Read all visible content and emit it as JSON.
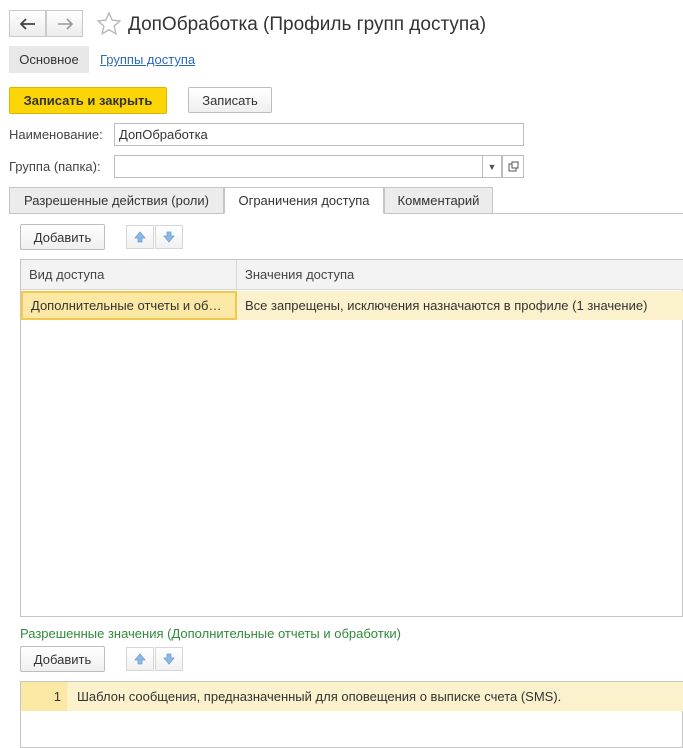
{
  "window": {
    "title": "ДопОбработка (Профиль групп доступа)"
  },
  "nav": {
    "back_icon": "arrow-left-icon",
    "forward_icon": "arrow-right-icon",
    "favorite_icon": "star-icon"
  },
  "sections": {
    "active": "Основное",
    "link": "Группы доступа"
  },
  "toolbar": {
    "save_close_label": "Записать и закрыть",
    "save_label": "Записать"
  },
  "fields": {
    "name_label": "Наименование:",
    "name_value": "ДопОбработка",
    "group_label": "Группа (папка):",
    "group_value": ""
  },
  "tabs": [
    {
      "label": "Разрешенные действия (роли)"
    },
    {
      "label": "Ограничения доступа"
    },
    {
      "label": "Комментарий"
    }
  ],
  "restrictions": {
    "add_label": "Добавить",
    "columns": [
      "Вид доступа",
      "Значения доступа"
    ],
    "rows": [
      {
        "kind": "Дополнительные отчеты и об…",
        "values": "Все запрещены, исключения назначаются в профиле (1 значение)"
      }
    ]
  },
  "allowed": {
    "title": "Разрешенные значения (Дополнительные отчеты и обработки)",
    "add_label": "Добавить",
    "rows": [
      {
        "num": "1",
        "value": "Шаблон сообщения, предназначенный для оповещения о выписке счета (SMS)."
      }
    ]
  },
  "colors": {
    "primary_button": "#fcd507",
    "link": "#2a6bb5",
    "selected_row": "#fbf1cc",
    "section_title": "#2f8a3c"
  }
}
